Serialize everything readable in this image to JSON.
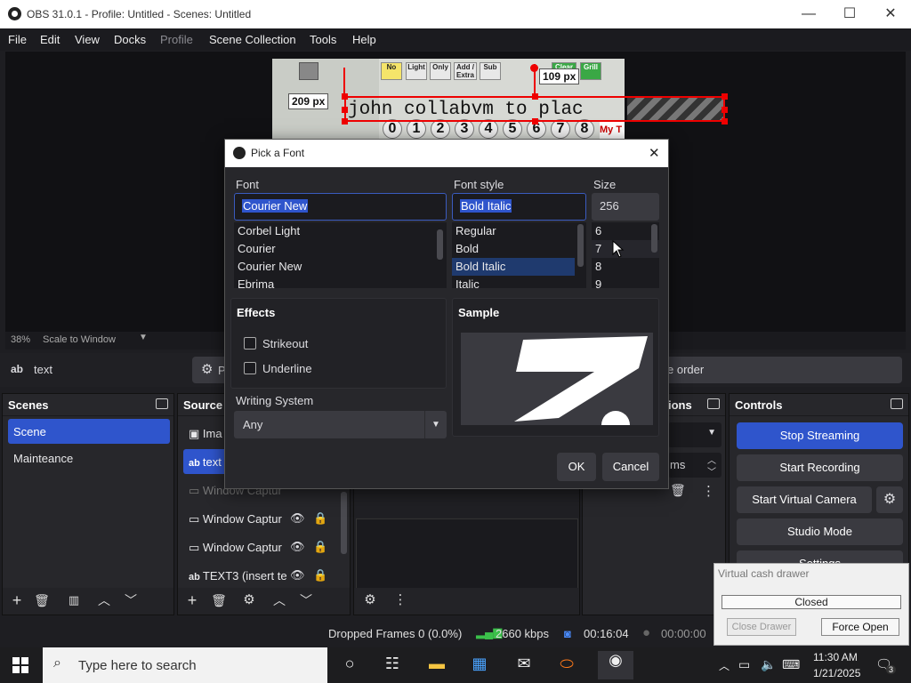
{
  "window": {
    "title": "OBS 31.0.1 - Profile: Untitled - Scenes: Untitled",
    "minimize": "—",
    "maximize": "☐",
    "close": "✕"
  },
  "menubar": [
    "File",
    "Edit",
    "View",
    "Docks",
    "Profile",
    "Scene Collection",
    "Tools",
    "Help"
  ],
  "preview": {
    "zoom": "38%",
    "scale_mode": "Scale to Window",
    "canvas": {
      "text_source": "john collabvm to plac",
      "px_label_1": "209 px",
      "px_label_2": "109 px",
      "buttons_top": [
        "No",
        "Light",
        "Only",
        "Add / Extra",
        "Sub",
        "Clear Grill",
        "Grill"
      ],
      "numbers": [
        "0",
        "1",
        "2",
        "3",
        "4",
        "5",
        "6",
        "7",
        "8"
      ],
      "corner_text": "My T"
    }
  },
  "source_toolbar": {
    "icon_label": "ab",
    "source_name": "text",
    "properties_prefix": "P",
    "order_label": "e order"
  },
  "scenes_dock": {
    "title": "Scenes",
    "items": [
      "Scene",
      "Mainteance"
    ],
    "selected": "Scene"
  },
  "sources_dock": {
    "title": "Source",
    "items": [
      {
        "icon": "ab",
        "label": "Ima"
      },
      {
        "icon": "ab",
        "label": "text"
      },
      {
        "icon": "window",
        "label": "Window Captur"
      },
      {
        "icon": "window",
        "label": "Window Captur"
      },
      {
        "icon": "window",
        "label": "Window Captur"
      },
      {
        "icon": "ab",
        "label": "TEXT3 (insert te"
      }
    ]
  },
  "transitions_dock": {
    "title": "ions",
    "duration_suffix": "ms"
  },
  "controls_dock": {
    "title": "Controls",
    "buttons": [
      "Stop Streaming",
      "Start Recording",
      "Start Virtual Camera",
      "Studio Mode",
      "Settings"
    ]
  },
  "statusbar": {
    "dropped_frames": "Dropped Frames 0 (0.0%)",
    "bitrate": "2660 kbps",
    "stream_time": "00:16:04",
    "record_time": "00:00:00"
  },
  "font_dialog": {
    "title": "Pick a Font",
    "close": "✕",
    "font_label": "Font",
    "font_value": "Courier New",
    "font_list": [
      "Corbel Light",
      "Courier",
      "Courier New",
      "Ebrima"
    ],
    "style_label": "Font style",
    "style_value": "Bold Italic",
    "style_list": [
      "Regular",
      "Bold",
      "Bold Italic",
      "Italic"
    ],
    "size_label": "Size",
    "size_value": "256",
    "size_list": [
      "6",
      "7",
      "8",
      "9"
    ],
    "effects_title": "Effects",
    "strikeout": "Strikeout",
    "underline": "Underline",
    "sample_title": "Sample",
    "writing_system_label": "Writing System",
    "writing_system_value": "Any",
    "ok": "OK",
    "cancel": "Cancel"
  },
  "virtual_cash_drawer": {
    "title": "Virtual cash drawer",
    "status": "Closed",
    "close_drawer": "Close Drawer",
    "force_open": "Force Open"
  },
  "taskbar": {
    "search_placeholder": "Type here to search",
    "time": "11:30 AM",
    "date": "1/21/2025",
    "notification_count": "3"
  }
}
